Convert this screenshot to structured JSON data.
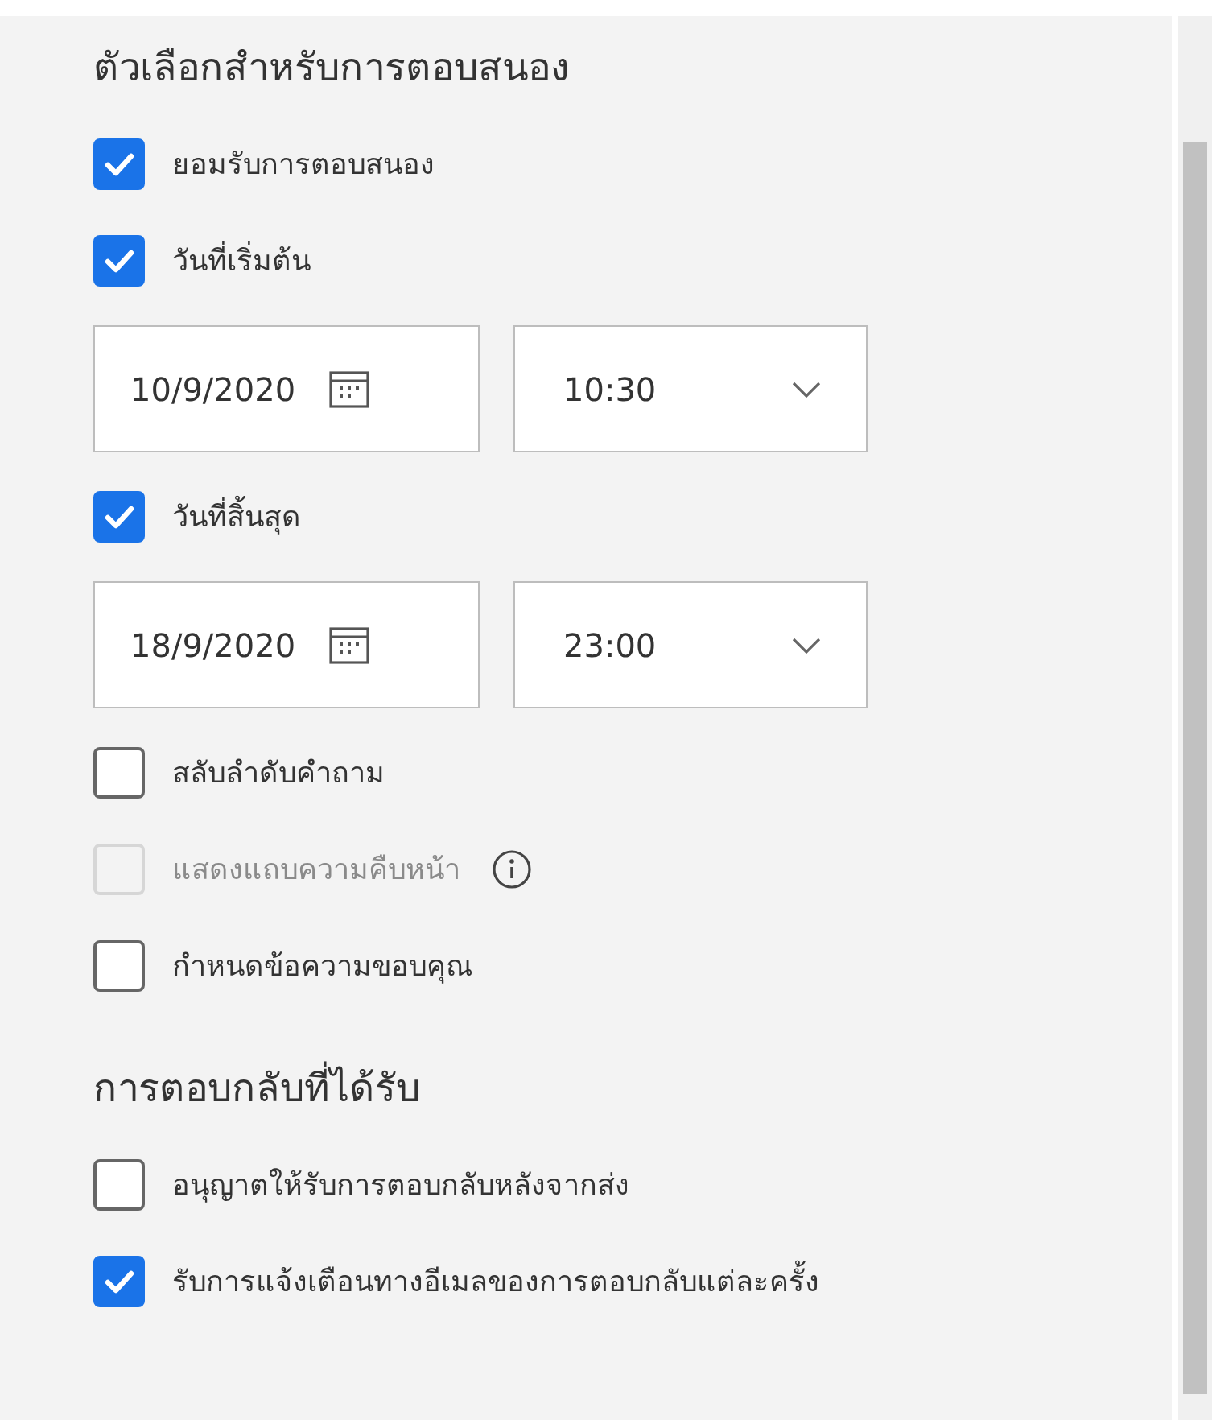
{
  "sections": [
    {
      "title": "ตัวเลือกสำหรับการตอบสนอง",
      "items": [
        {
          "kind": "checkbox",
          "label": "ยอมรับการตอบสนอง",
          "checked": true,
          "disabled": false,
          "info": false
        },
        {
          "kind": "checkbox",
          "label": "วันที่เริ่มต้น",
          "checked": true,
          "disabled": false,
          "info": false
        },
        {
          "kind": "datetime",
          "date": "10/9/2020",
          "time": "10:30"
        },
        {
          "kind": "checkbox",
          "label": "วันที่สิ้นสุด",
          "checked": true,
          "disabled": false,
          "info": false
        },
        {
          "kind": "datetime",
          "date": "18/9/2020",
          "time": "23:00"
        },
        {
          "kind": "checkbox",
          "label": "สลับลำดับคำถาม",
          "checked": false,
          "disabled": false,
          "info": false
        },
        {
          "kind": "checkbox",
          "label": "แสดงแถบความคืบหน้า",
          "checked": false,
          "disabled": true,
          "info": true
        },
        {
          "kind": "checkbox",
          "label": "กำหนดข้อความขอบคุณ",
          "checked": false,
          "disabled": false,
          "info": false
        }
      ]
    },
    {
      "title": "การตอบกลับที่ได้รับ",
      "items": [
        {
          "kind": "checkbox",
          "label": "อนุญาตให้รับการตอบกลับหลังจากส่ง",
          "checked": false,
          "disabled": false,
          "info": false
        },
        {
          "kind": "checkbox",
          "label": "รับการแจ้งเตือนทางอีเมลของการตอบกลับแต่ละครั้ง",
          "checked": true,
          "disabled": false,
          "info": false
        }
      ]
    }
  ]
}
